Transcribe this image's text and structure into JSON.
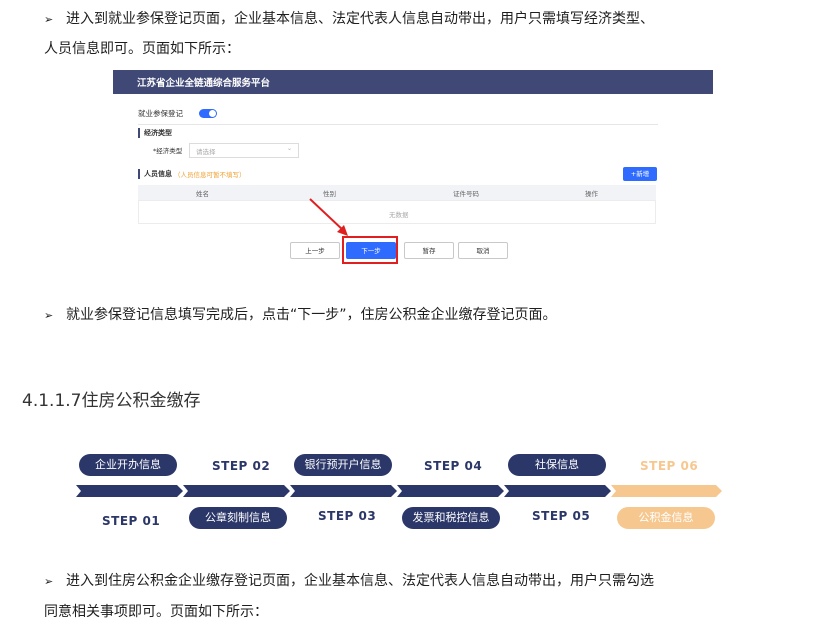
{
  "bullet_marker": "➢",
  "para1": {
    "line1": "进入到就业参保登记页面，企业基本信息、法定代表人信息自动带出，用户只需填写经济类型、",
    "line2": "人员信息即可。页面如下所示："
  },
  "screenshot": {
    "platform_title": "江苏省企业全链通综合服务平台",
    "page_label": "就业参保登记",
    "section_econ": "经济类型",
    "econ_field_label": "*经济类型",
    "econ_placeholder": "请选择",
    "section_person": "人员信息",
    "person_hint": "（人员信息可暂不填写）",
    "add_button": "+新增",
    "table_headers": [
      "姓名",
      "性别",
      "证件号码",
      "操作"
    ],
    "empty_text": "无数据",
    "buttons": {
      "prev": "上一步",
      "next": "下一步",
      "save": "暂存",
      "cancel": "取消"
    }
  },
  "para2": "就业参保登记信息填写完成后，点击“下一步”，住房公积金企业缴存登记页面。",
  "section_heading": "4.1.1.7住房公积金缴存",
  "steps": {
    "top_row": [
      "企业开办信息",
      "STEP 02",
      "银行预开户信息",
      "STEP 04",
      "社保信息",
      "STEP 06"
    ],
    "bottom_row": [
      "STEP 01",
      "公章刻制信息",
      "STEP 03",
      "发票和税控信息",
      "STEP 05",
      "公积金信息"
    ],
    "colors": {
      "done": "#2b3768",
      "current": "#f6c890"
    }
  },
  "para3": {
    "line1": "进入到住房公积金企业缴存登记页面，企业基本信息、法定代表人信息自动带出，用户只需勾选",
    "line2": "同意相关事项即可。页面如下所示："
  }
}
